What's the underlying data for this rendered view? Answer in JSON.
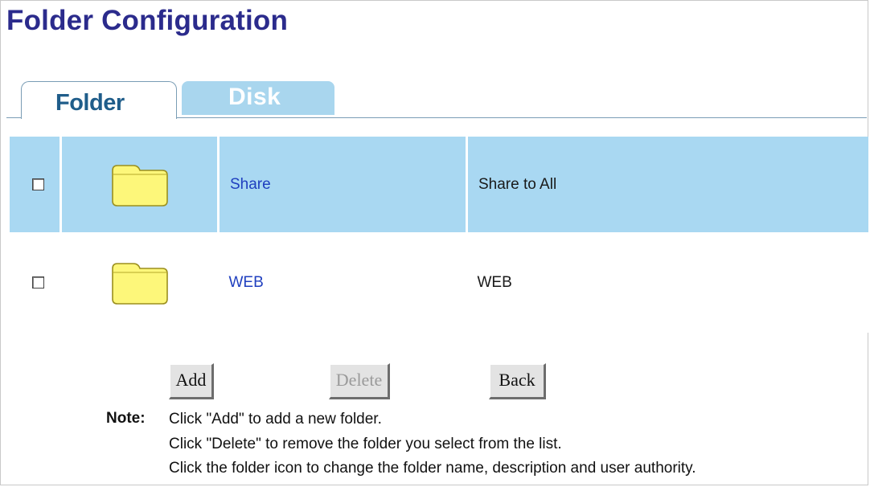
{
  "page": {
    "title": "Folder Configuration"
  },
  "tabs": {
    "folder": "Folder",
    "disk": "Disk"
  },
  "colors": {
    "title": "#2b2b8c",
    "row_highlight": "#a9d8f2",
    "link": "#1f3fbf",
    "folder_fill": "#fdf77a"
  },
  "folders": [
    {
      "name": "Share",
      "description": "Share to All",
      "checked": false,
      "icon": "folder-icon"
    },
    {
      "name": "WEB",
      "description": "WEB",
      "checked": false,
      "icon": "folder-icon"
    }
  ],
  "buttons": {
    "add": "Add",
    "delete": "Delete",
    "back": "Back"
  },
  "note": {
    "label": "Note:",
    "lines": [
      "Click \"Add\" to add a new folder.",
      "Click \"Delete\" to remove the folder you select from the list.",
      "Click the folder icon to change the folder name, description and user authority."
    ]
  }
}
